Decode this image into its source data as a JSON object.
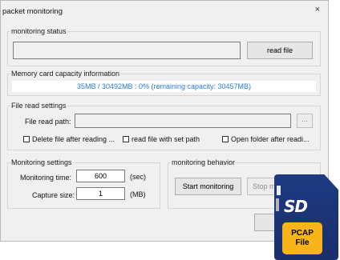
{
  "window": {
    "title": "packet monitoring",
    "close_glyph": "×"
  },
  "monitoring_status": {
    "group_title": "monitoring status",
    "status_text": "",
    "read_file_label": "read file"
  },
  "memory_card": {
    "group_title": "Memory card capacity information",
    "capacity_text": "35MB / 30492MB : 0% (remaining capacity: 30457MB)"
  },
  "file_read": {
    "group_title": "File read settings",
    "path_label": "File read path:",
    "path_value": "",
    "browse_label": "...",
    "checkboxes": [
      {
        "label": "Delete file after reading ...",
        "checked": false
      },
      {
        "label": "read file with set path",
        "checked": false
      },
      {
        "label": "Open folder after readi...",
        "checked": false
      }
    ]
  },
  "monitoring_settings": {
    "group_title": "Monitoring settings",
    "time_label": "Monitoring time:",
    "time_value": "600",
    "time_unit": "(sec)",
    "size_label": "Capture size:",
    "size_value": "1",
    "size_unit": "(MB)"
  },
  "monitoring_behavior": {
    "group_title": "monitoring behavior",
    "start_label": "Start monitoring",
    "stop_label": "Stop mo"
  },
  "overlay": {
    "sd_logo_text": "SD",
    "label_line1": "PCAP",
    "label_line2": "File",
    "colors": {
      "card": "#1e3a82",
      "label": "#f8b51a"
    }
  }
}
